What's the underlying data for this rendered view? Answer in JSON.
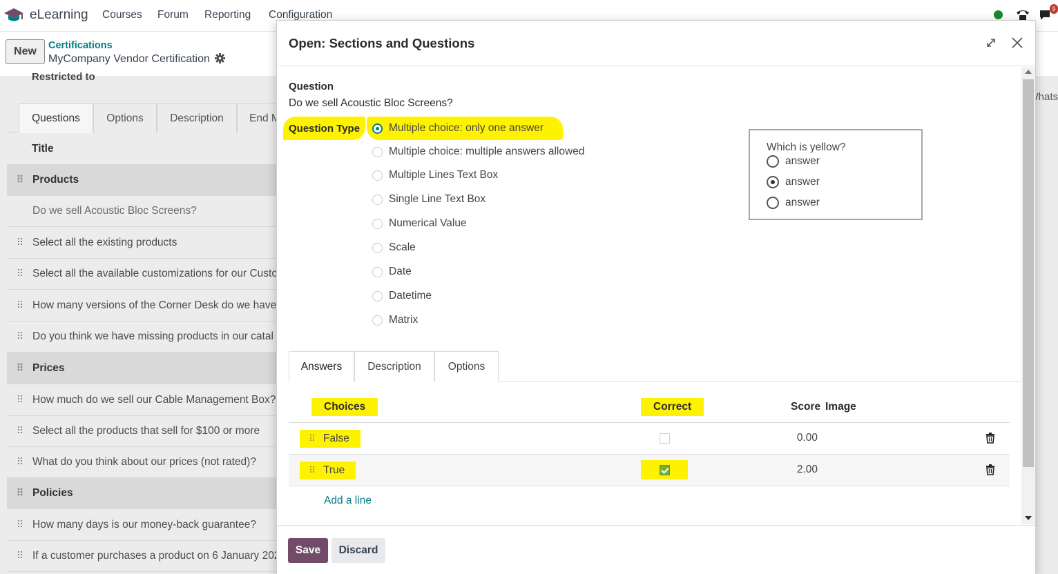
{
  "app": {
    "brand": "eLearning",
    "menu": [
      "Courses",
      "Forum",
      "Reporting",
      "Configuration"
    ],
    "notification_count": "9"
  },
  "control_panel": {
    "new_button": "New",
    "breadcrumb_parent": "Certifications",
    "breadcrumb_current": "MyCompany Vendor Certification"
  },
  "background_form": {
    "restricted_to_label": "Restricted to",
    "right_fragment": "Whats",
    "tabs": [
      "Questions",
      "Options",
      "Description",
      "End M"
    ],
    "title_header": "Title",
    "rows": [
      {
        "text": "Products",
        "section": true
      },
      {
        "text": "Do we sell Acoustic Bloc Screens?",
        "section": false
      },
      {
        "text": "Select all the existing products",
        "section": false
      },
      {
        "text": "Select all the available customizations for our Custo",
        "section": false
      },
      {
        "text": "How many versions of the Corner Desk do we have",
        "section": false
      },
      {
        "text": "Do you think we have missing products in our catal",
        "section": false
      },
      {
        "text": "Prices",
        "section": true
      },
      {
        "text": "How much do we sell our Cable Management Box?",
        "section": false
      },
      {
        "text": "Select all the products that sell for $100 or more",
        "section": false
      },
      {
        "text": "What do you think about our prices (not rated)?",
        "section": false
      },
      {
        "text": "Policies",
        "section": true
      },
      {
        "text": "How many days is our money-back guarantee?",
        "section": false
      },
      {
        "text": "If a customer purchases a product on 6 January 202",
        "section": false
      }
    ]
  },
  "dialog": {
    "title": "Open: Sections and Questions",
    "question_label": "Question",
    "question_text": "Do we sell Acoustic Bloc Screens?",
    "question_type_label": "Question Type",
    "question_types": [
      {
        "label": "Multiple choice: only one answer",
        "checked": true
      },
      {
        "label": "Multiple choice: multiple answers allowed",
        "checked": false
      },
      {
        "label": "Multiple Lines Text Box",
        "checked": false
      },
      {
        "label": "Single Line Text Box",
        "checked": false
      },
      {
        "label": "Numerical Value",
        "checked": false
      },
      {
        "label": "Scale",
        "checked": false
      },
      {
        "label": "Date",
        "checked": false
      },
      {
        "label": "Datetime",
        "checked": false
      },
      {
        "label": "Matrix",
        "checked": false
      }
    ],
    "preview": {
      "title": "Which is yellow?",
      "options": [
        {
          "label": "answer",
          "checked": false
        },
        {
          "label": "answer",
          "checked": true
        },
        {
          "label": "answer",
          "checked": false
        }
      ]
    },
    "tabs": [
      "Answers",
      "Description",
      "Options"
    ],
    "answers": {
      "columns": {
        "choices": "Choices",
        "correct": "Correct",
        "score": "Score",
        "image": "Image"
      },
      "rows": [
        {
          "choice": "False",
          "correct": false,
          "score": "0.00"
        },
        {
          "choice": "True",
          "correct": true,
          "score": "2.00"
        }
      ],
      "add_line": "Add a line"
    },
    "footer": {
      "save": "Save",
      "discard": "Discard"
    }
  },
  "colors": {
    "accent_teal": "#017e84",
    "primary_purple": "#714b67",
    "highlight_yellow": "#fff200",
    "checkbox_green": "#71b238"
  }
}
